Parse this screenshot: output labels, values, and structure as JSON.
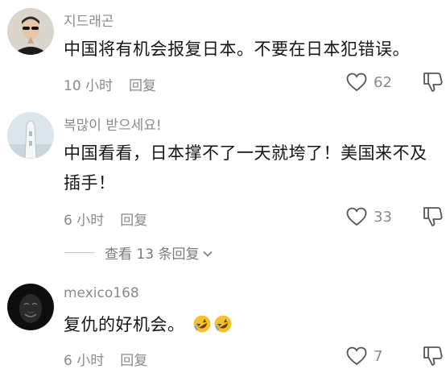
{
  "comments": [
    {
      "username": "지드래곤",
      "text": "中国将有机会报复日本。不要在日本犯错误。",
      "time": "10 小时",
      "reply_label": "回复",
      "likes": "62"
    },
    {
      "username": "복많이 받으세요!",
      "text": "中国看看，日本撑不了一天就垮了！美国来不及插手！",
      "time": "6 小时",
      "reply_label": "回复",
      "likes": "33"
    },
    {
      "username": "mexico168",
      "text": "复仇的好机会。",
      "time": "6 小时",
      "reply_label": "回复",
      "likes": "7"
    }
  ],
  "more_replies": {
    "label": "查看 13 条回复"
  },
  "icons": {
    "like": "heart-outline-icon",
    "dislike": "thumbs-down-icon",
    "expand": "chevron-down-icon",
    "emoji": "rolling-on-floor-laughing-emoji"
  },
  "colors": {
    "text_primary": "#161616",
    "text_secondary": "#8a8a8a",
    "icon": "#555555"
  }
}
